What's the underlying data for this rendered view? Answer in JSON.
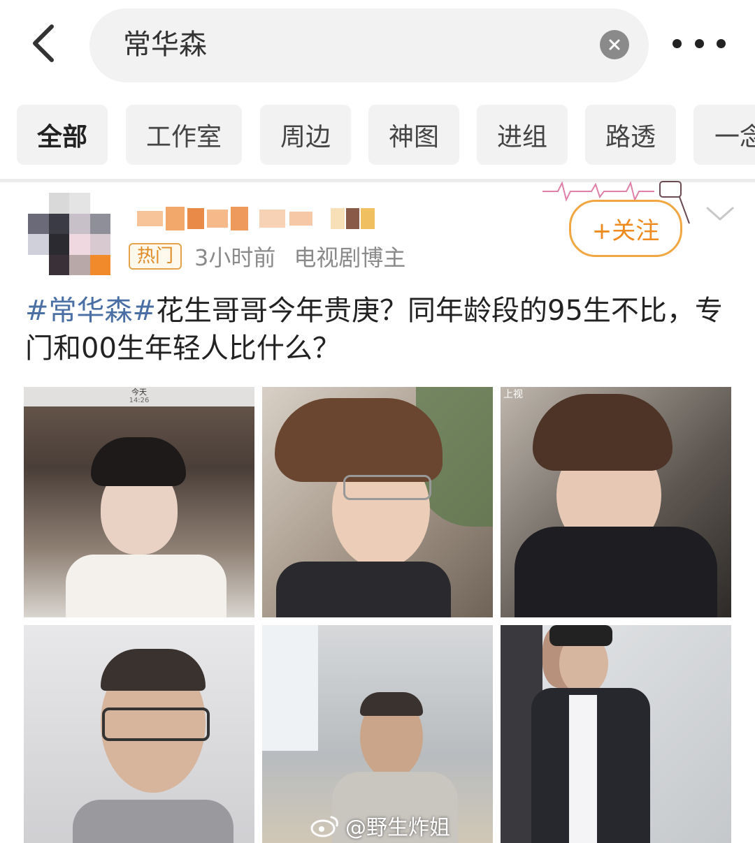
{
  "search": {
    "query": "常华森"
  },
  "tabs": [
    {
      "label": "全部",
      "active": true
    },
    {
      "label": "工作室"
    },
    {
      "label": "周边"
    },
    {
      "label": "神图"
    },
    {
      "label": "进组"
    },
    {
      "label": "路透"
    },
    {
      "label": "一念"
    }
  ],
  "post": {
    "badge": "热门",
    "time": "3小时前",
    "source": "电视剧博主",
    "follow_label": "+关注",
    "hashtag": "#常华森#",
    "body": "花生哥哥今年贵庚？同年龄段的95生不比，专门和00生年轻人比什么？"
  },
  "images": [
    {
      "overlay_top": "今天",
      "overlay_time": "14:26"
    },
    {},
    {
      "overlay_top": "上视"
    },
    {},
    {},
    {}
  ],
  "watermark": {
    "text": "@野生炸姐"
  },
  "colors": {
    "accent": "#ef8a1f",
    "hashtag": "#4a6fa5",
    "tab_bg": "#f2f2f2"
  }
}
